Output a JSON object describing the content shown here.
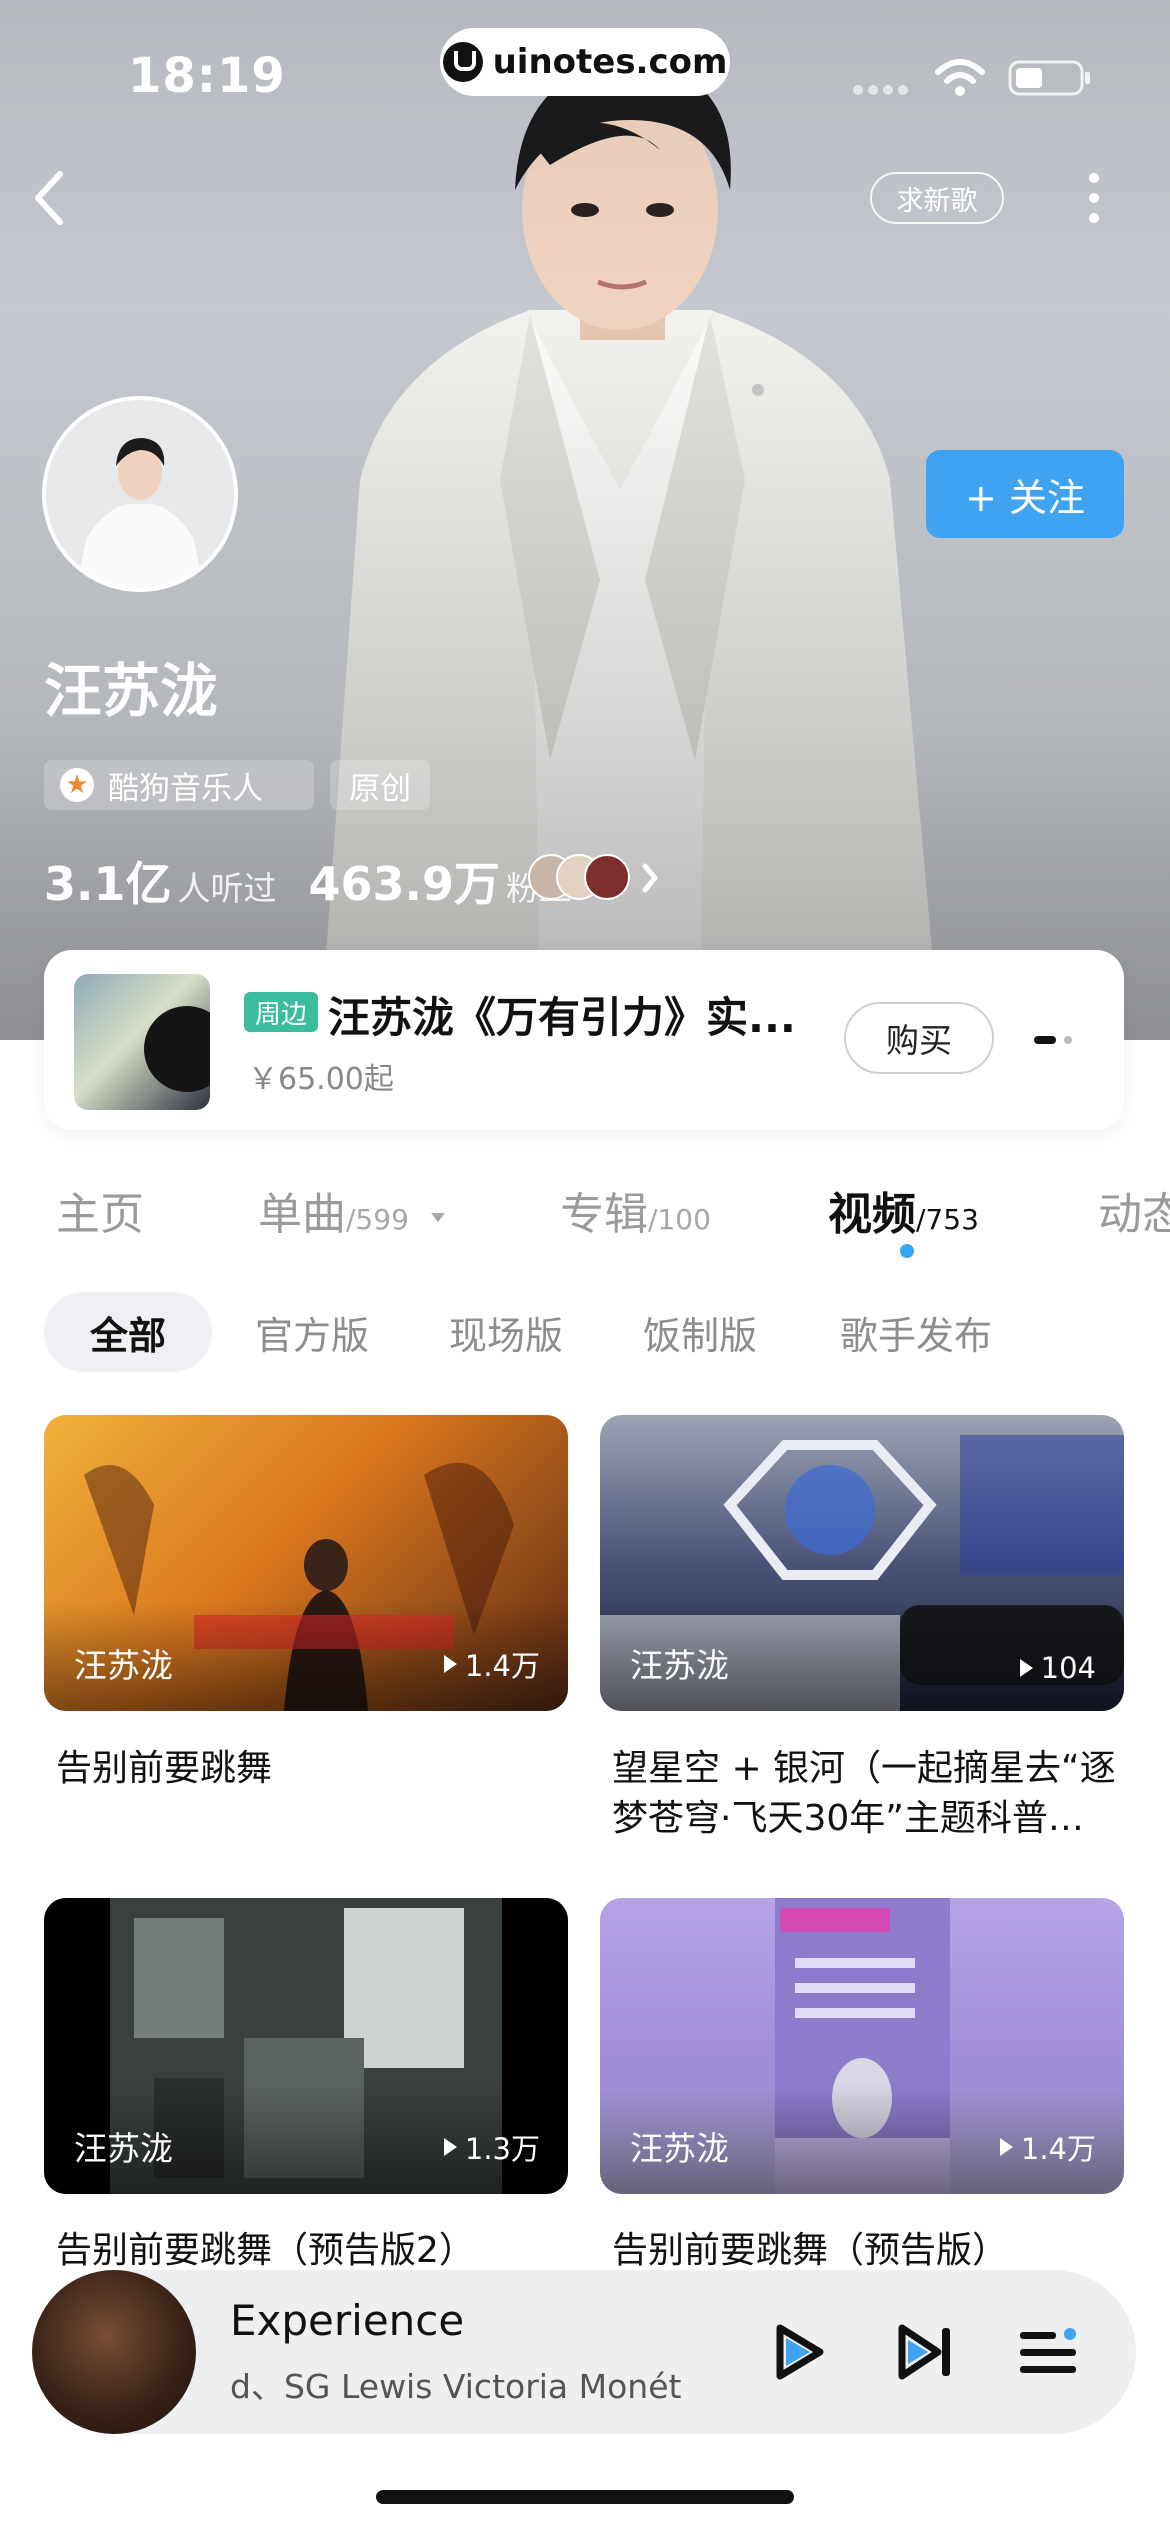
{
  "status": {
    "time": "18:19"
  },
  "browser": {
    "url": "uinotes.com"
  },
  "header": {
    "request_song_label": "求新歌"
  },
  "artist": {
    "name": "汪苏泷",
    "tags": [
      "酷狗音乐人",
      "原创"
    ],
    "plays_value": "3.1亿",
    "plays_label": "人听过",
    "fans_value": "463.9万",
    "fans_label": "粉丝",
    "follow_label": "+ 关注"
  },
  "merch": {
    "badge": "周边",
    "title": "汪苏泷《万有引力》实...",
    "price": "￥65.00起",
    "buy_label": "购买"
  },
  "tabs": [
    {
      "label": "主页",
      "count": ""
    },
    {
      "label": "单曲",
      "count": "/599"
    },
    {
      "label": "专辑",
      "count": "/100"
    },
    {
      "label": "视频",
      "count": "/753"
    },
    {
      "label": "动态",
      "count": ""
    }
  ],
  "filters": [
    "全部",
    "官方版",
    "现场版",
    "饭制版",
    "歌手发布"
  ],
  "videos": [
    {
      "artist": "汪苏泷",
      "plays": "1.4万",
      "title": "告别前要跳舞"
    },
    {
      "artist": "汪苏泷",
      "plays": "104",
      "title": "望星空 + 银河（一起摘星去“逐梦苍穹·飞天30年”主题科普…"
    },
    {
      "artist": "汪苏泷",
      "plays": "1.3万",
      "title": "告别前要跳舞（预告版2）"
    },
    {
      "artist": "汪苏泷",
      "plays": "1.4万",
      "title": "告别前要跳舞（预告版）"
    }
  ],
  "player": {
    "title": "Experience",
    "subtitle": "d、SG Lewis        Victoria Monét"
  },
  "colors": {
    "accent": "#3fa3f2",
    "merch_badge": "#3bbd9e"
  }
}
